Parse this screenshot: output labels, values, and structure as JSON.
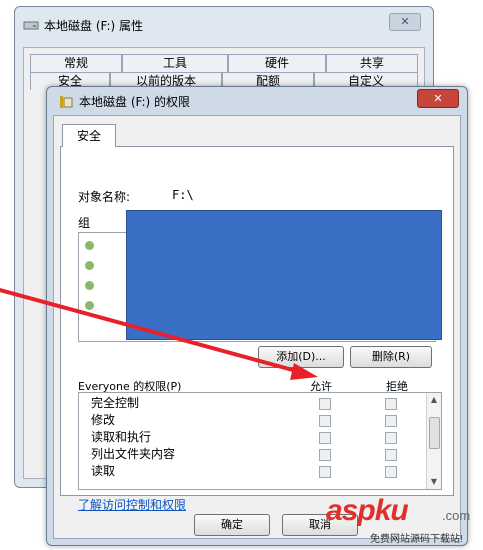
{
  "background_window": {
    "title": "本地磁盘 (F:) 属性",
    "close_glyph": "✕",
    "tabs_row1": [
      "常规",
      "工具",
      "硬件",
      "共享"
    ],
    "tabs_row2": [
      "安全",
      "以前的版本",
      "配额",
      "自定义"
    ]
  },
  "dialog": {
    "title": "本地磁盘 (F:) 的权限",
    "close_glyph": "✕",
    "tab_label": "安全",
    "object_label": "对象名称:",
    "object_value": "F:\\",
    "group_label": "组",
    "add_button": "添加(D)...",
    "remove_button": "删除(R)",
    "perm_title": "Everyone 的权限(P)",
    "allow_label": "允许",
    "deny_label": "拒绝",
    "permissions": [
      {
        "name": "完全控制",
        "allow": false,
        "deny": false
      },
      {
        "name": "修改",
        "allow": false,
        "deny": false
      },
      {
        "name": "读取和执行",
        "allow": false,
        "deny": false
      },
      {
        "name": "列出文件夹内容",
        "allow": false,
        "deny": false
      },
      {
        "name": "读取",
        "allow": false,
        "deny": false
      }
    ],
    "help_link": "了解访问控制和权限",
    "ok_button": "确定",
    "cancel_button": "取消"
  },
  "watermark": {
    "brand": "aspku",
    "domain": ".com",
    "tagline": "免费网站源码下载站!"
  },
  "colors": {
    "arrow": "#e8202a",
    "redaction": "#3a6fc6"
  }
}
